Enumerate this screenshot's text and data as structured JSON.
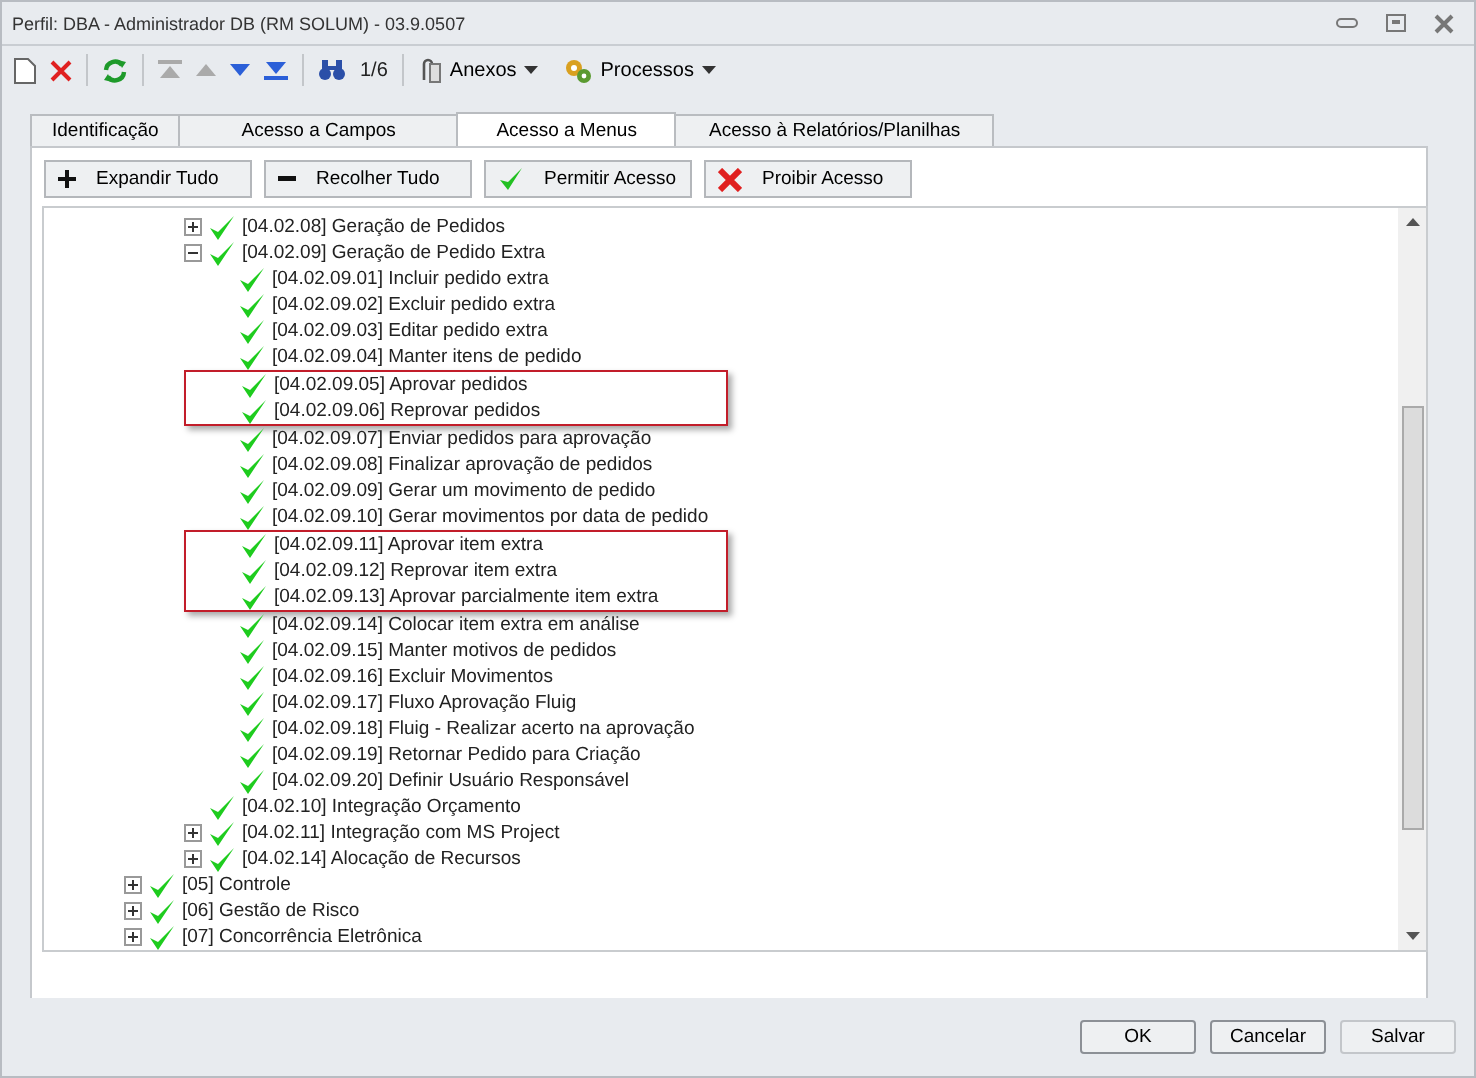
{
  "window": {
    "title": "Perfil: DBA - Administrador DB (RM SOLUM) - 03.9.0507"
  },
  "toolbar": {
    "page_counter": "1/6",
    "menus": [
      {
        "label": "Anexos",
        "kind": "attach"
      },
      {
        "label": "Processos",
        "kind": "gears"
      }
    ]
  },
  "tabs": [
    {
      "label": "Identificação",
      "selected": false
    },
    {
      "label": "Acesso a Campos",
      "selected": false
    },
    {
      "label": "Acesso a Menus",
      "selected": true
    },
    {
      "label": "Acesso à Relatórios/Planilhas",
      "selected": false
    }
  ],
  "actions": [
    {
      "label": "Expandir Tudo",
      "kind": "plus"
    },
    {
      "label": "Recolher Tudo",
      "kind": "minus"
    },
    {
      "label": "Permitir Acesso",
      "kind": "check"
    },
    {
      "label": "Proibir Acesso",
      "kind": "cross"
    }
  ],
  "tree": [
    {
      "children": [
        {
          "label": "[04.02.08] Geração de Pedidos",
          "expanded": false
        },
        {
          "label": "[04.02.09] Geração de Pedido Extra",
          "expanded": true,
          "children": [
            {
              "label": "[04.02.09.01] Incluir pedido extra",
              "highlighted": false
            },
            {
              "label": "[04.02.09.02] Excluir pedido extra",
              "highlighted": false
            },
            {
              "label": "[04.02.09.03] Editar pedido extra",
              "highlighted": false
            },
            {
              "label": "[04.02.09.04] Manter itens de pedido",
              "highlighted": false
            },
            {
              "label": "[04.02.09.05] Aprovar pedidos",
              "highlighted": true
            },
            {
              "label": "[04.02.09.06] Reprovar pedidos",
              "highlighted": true
            },
            {
              "label": "[04.02.09.07] Enviar pedidos para aprovação",
              "highlighted": false
            },
            {
              "label": "[04.02.09.08] Finalizar aprovação de pedidos",
              "highlighted": false
            },
            {
              "label": "[04.02.09.09] Gerar um movimento de pedido",
              "highlighted": false
            },
            {
              "label": "[04.02.09.10] Gerar movimentos por data de pedido",
              "highlighted": false
            },
            {
              "label": "[04.02.09.11] Aprovar item extra",
              "highlighted": true
            },
            {
              "label": "[04.02.09.12] Reprovar item extra",
              "highlighted": true
            },
            {
              "label": "[04.02.09.13] Aprovar parcialmente item extra",
              "highlighted": true
            },
            {
              "label": "[04.02.09.14] Colocar item extra em análise",
              "highlighted": false
            },
            {
              "label": "[04.02.09.15] Manter motivos de pedidos",
              "highlighted": false
            },
            {
              "label": "[04.02.09.16] Excluir Movimentos",
              "highlighted": false
            },
            {
              "label": "[04.02.09.17] Fluxo Aprovação Fluig",
              "highlighted": false
            },
            {
              "label": "[04.02.09.18] Fluig - Realizar acerto na aprovação",
              "highlighted": false
            },
            {
              "label": "[04.02.09.19] Retornar Pedido para Criação",
              "highlighted": false
            },
            {
              "label": "[04.02.09.20] Definir Usuário Responsável",
              "highlighted": false
            }
          ]
        },
        {
          "label": "[04.02.10] Integração Orçamento"
        },
        {
          "label": "[04.02.11] Integração com MS Project",
          "expanded": false
        },
        {
          "label": "[04.02.14] Alocação de Recursos",
          "expanded": false
        }
      ]
    },
    {
      "label": "[05] Controle",
      "expanded": false
    },
    {
      "label": "[06] Gestão de Risco",
      "expanded": false
    },
    {
      "label": "[07] Concorrência Eletrônica",
      "expanded": false
    }
  ],
  "buttons": [
    {
      "label": "OK",
      "kind": "default"
    },
    {
      "label": "Cancelar",
      "kind": "default"
    },
    {
      "label": "Salvar",
      "kind": "secondary"
    }
  ]
}
